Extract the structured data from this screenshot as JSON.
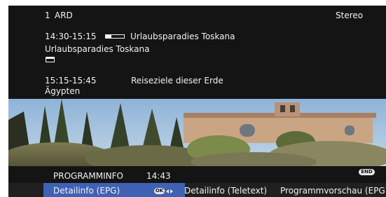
{
  "channel": {
    "number": "1",
    "name": "ARD",
    "audio": "Stereo"
  },
  "current_program": {
    "time": "14:30-15:15",
    "title": "Urlaubsparadies Toskana",
    "subtitle": "Urlaubsparadies Toskana",
    "progress": 0.3
  },
  "next_program": {
    "time": "15:15-15:45",
    "title": "Reiseziele dieser Erde",
    "subtitle": "Ägypten"
  },
  "bottom_bar": {
    "title": "PROGRAMMINFO",
    "clock": "14:43",
    "end_label": "END",
    "ok_label": "OK",
    "tabs": [
      {
        "label": "Detailinfo (EPG)",
        "active": true
      },
      {
        "label": "Detailinfo (Teletext)",
        "active": false
      },
      {
        "label": "Programmvorschau (EPG)",
        "active": false
      }
    ]
  },
  "colors": {
    "active_tab": "#3f62b5",
    "osd_background": "#141414"
  }
}
